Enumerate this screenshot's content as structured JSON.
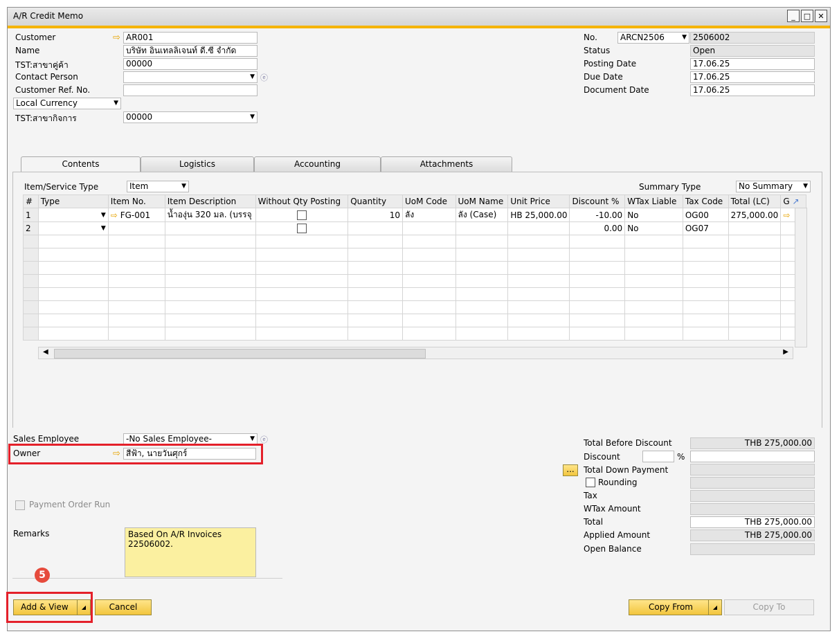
{
  "window": {
    "title": "A/R Credit Memo"
  },
  "header_left": {
    "customer": {
      "label": "Customer",
      "value": "AR001"
    },
    "name": {
      "label": "Name",
      "value": "บริษัท อินเทลลิเจนท์ ดี.ซี จำกัด"
    },
    "branch": {
      "label": "TST:สาขาคู่ค้า",
      "value": "00000"
    },
    "contact_person": {
      "label": "Contact Person",
      "value": ""
    },
    "customer_ref": {
      "label": "Customer Ref. No.",
      "value": ""
    },
    "currency": {
      "value": "Local Currency"
    },
    "business_place": {
      "label": "TST:สาขากิจการ",
      "value": "00000"
    }
  },
  "header_right": {
    "no": {
      "label": "No.",
      "series": "ARCN2506",
      "value": "2506002"
    },
    "status": {
      "label": "Status",
      "value": "Open"
    },
    "posting_date": {
      "label": "Posting Date",
      "value": "17.06.25"
    },
    "due_date": {
      "label": "Due Date",
      "value": "17.06.25"
    },
    "document_date": {
      "label": "Document Date",
      "value": "17.06.25"
    }
  },
  "tabs": [
    {
      "label": "Contents"
    },
    {
      "label": "Logistics"
    },
    {
      "label": "Accounting"
    },
    {
      "label": "Attachments"
    }
  ],
  "contents": {
    "item_service_type_label": "Item/Service Type",
    "item_service_type_value": "Item",
    "summary_type_label": "Summary Type",
    "summary_type_value": "No Summary",
    "columns": [
      "#",
      "Type",
      "Item No.",
      "Item Description",
      "Without Qty Posting",
      "Quantity",
      "UoM Code",
      "UoM Name",
      "Unit Price",
      "Discount %",
      "WTax Liable",
      "Tax Code",
      "Total (LC)",
      "G"
    ],
    "rows": [
      {
        "num": "1",
        "item_no": "FG-001",
        "description": "น้ำองุ่น 320 มล. (บรรจุ",
        "quantity": "10",
        "uom_code": "ลัง",
        "uom_name": "ลัง (Case)",
        "unit_price": "HB 25,000.00",
        "discount": "-10.00",
        "wtax": "No",
        "tax_code": "OG00",
        "total": "275,000.00"
      },
      {
        "num": "2",
        "item_no": "",
        "description": "",
        "quantity": "",
        "uom_code": "",
        "uom_name": "",
        "unit_price": "",
        "discount": "0.00",
        "wtax": "No",
        "tax_code": "OG07",
        "total": ""
      }
    ]
  },
  "footer_left": {
    "sales_employee": {
      "label": "Sales Employee",
      "value": "-No Sales Employee-"
    },
    "owner": {
      "label": "Owner",
      "value": "สีฟ้า, นายวันศุกร์"
    },
    "payment_order_run": "Payment Order Run",
    "remarks_label": "Remarks",
    "remarks_text": "Based On A/R Invoices 22506002."
  },
  "totals": {
    "total_before_discount": {
      "label": "Total Before Discount",
      "value": "THB 275,000.00"
    },
    "discount": {
      "label": "Discount",
      "pct_symbol": "%"
    },
    "total_down_payment": {
      "label": "Total Down Payment",
      "btn": "..."
    },
    "rounding": {
      "label": "Rounding"
    },
    "tax": {
      "label": "Tax"
    },
    "wtax_amount": {
      "label": "WTax Amount"
    },
    "total": {
      "label": "Total",
      "value": "THB 275,000.00"
    },
    "applied_amount": {
      "label": "Applied Amount",
      "value": "THB 275,000.00"
    },
    "open_balance": {
      "label": "Open Balance"
    }
  },
  "buttons": {
    "add_view": "Add & View",
    "cancel": "Cancel",
    "copy_from": "Copy From",
    "copy_to": "Copy To"
  },
  "annotation": {
    "step": "5"
  },
  "colors": {
    "accent": "#f5b400",
    "button": "#f2c53d",
    "highlight": "#e4202a",
    "remarks_bg": "#fbf0a0"
  }
}
